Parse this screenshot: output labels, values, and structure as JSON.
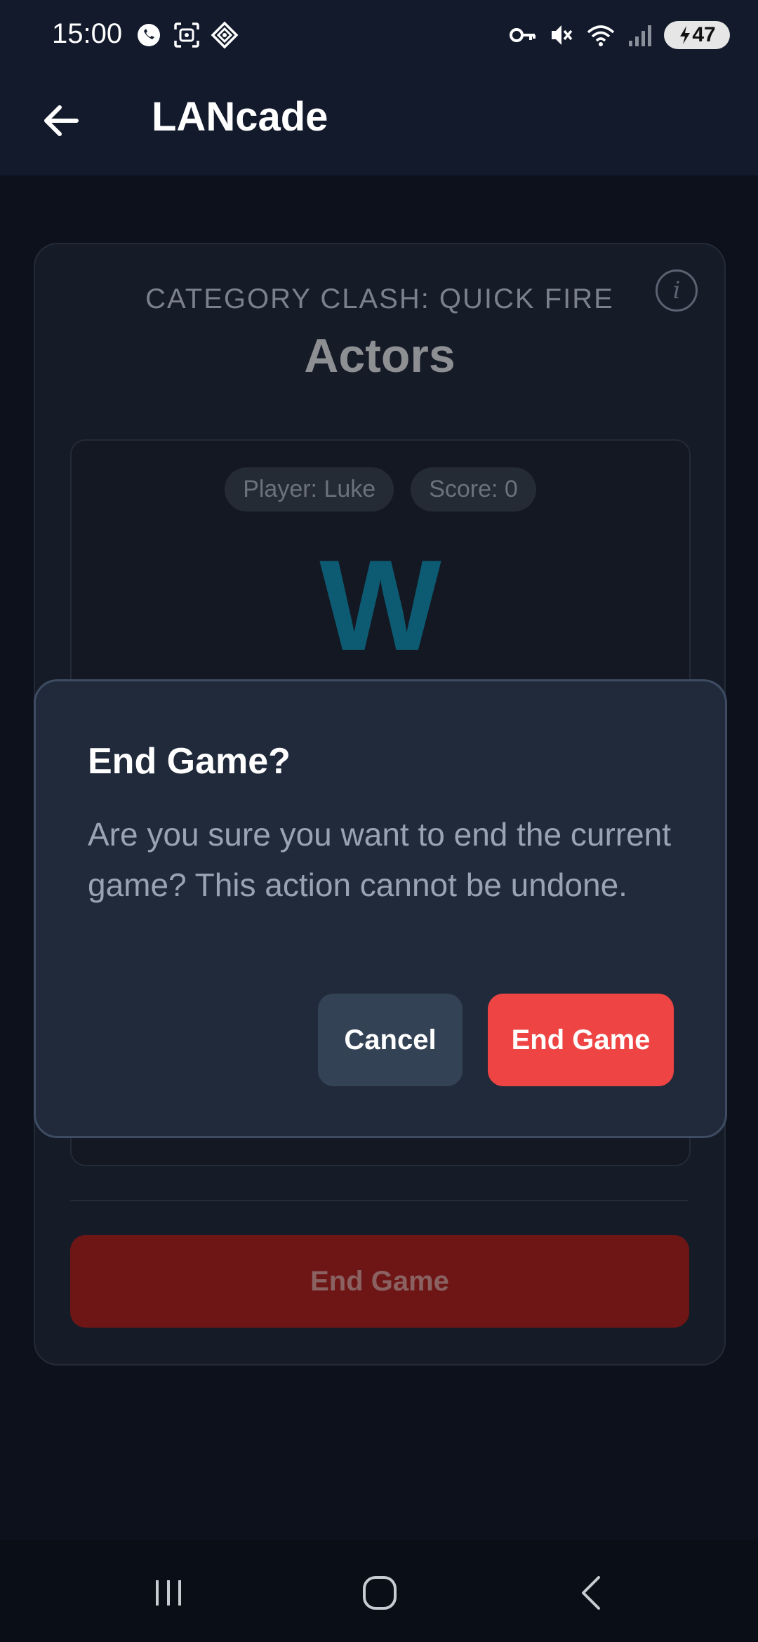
{
  "status_bar": {
    "time": "15:00",
    "battery": "47",
    "left_icons": [
      "whatsapp-icon",
      "face-scan-icon",
      "diamond-app-icon"
    ],
    "right_icons": [
      "vpn-key-icon",
      "mute-icon",
      "wifi-icon",
      "signal-icon",
      "battery-charging-icon"
    ]
  },
  "app_bar": {
    "title": "LANcade",
    "back_icon": "arrow-left-icon"
  },
  "game": {
    "mode": "CATEGORY CLASH: QUICK FIRE",
    "category": "Actors",
    "player_chip": "Player: Luke",
    "score_chip": "Score: 0",
    "letter": "W",
    "end_game_label": "End Game",
    "letter_color": "#0d5b72"
  },
  "dialog": {
    "title": "End Game?",
    "body": "Are you sure you want to end the current game? This action cannot be undone.",
    "cancel_label": "Cancel",
    "confirm_label": "End Game",
    "confirm_color": "#ef4444"
  },
  "nav_bar": {
    "icons": [
      "recent-apps-icon",
      "home-icon",
      "back-icon"
    ]
  }
}
